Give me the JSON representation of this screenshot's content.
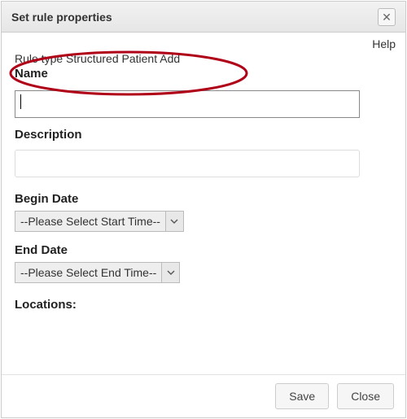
{
  "titlebar": {
    "title": "Set rule properties",
    "close_symbol": "✕"
  },
  "help": {
    "label": "Help"
  },
  "rule_type": {
    "prefix": "Rule type ",
    "value": "Structured Patient Add"
  },
  "form": {
    "name_label": "Name",
    "name_value": "",
    "description_label": "Description",
    "description_value": "",
    "begin_date_label": "Begin Date",
    "begin_date_selected": "--Please Select Start Time--",
    "end_date_label": "End Date",
    "end_date_selected": "--Please Select End Time--",
    "locations_label": "Locations:"
  },
  "footer": {
    "save_label": "Save",
    "close_label": "Close"
  }
}
